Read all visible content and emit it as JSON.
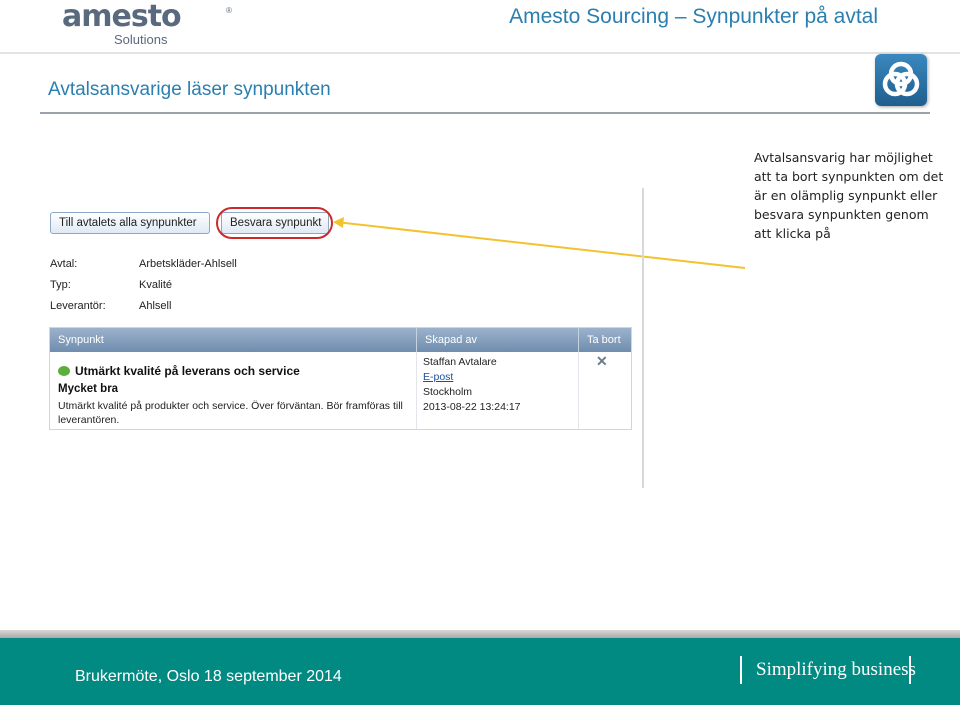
{
  "header": {
    "logo_text": "amesto",
    "logo_registered": "®",
    "logo_sub": "Solutions",
    "title": "Amesto Sourcing – Synpunkter på avtal"
  },
  "slide": {
    "title": "Avtalsansvarige läser synpunkten",
    "callout": "Avtalsansvarig har möjlighet att ta bort synpunkten om det är en olämplig synpunkt eller besvara synpunkten genom att klicka på"
  },
  "screen": {
    "buttons": {
      "all": "Till avtalets alla synpunkter",
      "answer": "Besvara synpunkt"
    },
    "meta": [
      {
        "label": "Avtal:",
        "value": "Arbetskläder-Ahlsell"
      },
      {
        "label": "Typ:",
        "value": "Kvalité"
      },
      {
        "label": "Leverantör:",
        "value": "Ahlsell"
      }
    ],
    "table": {
      "headers": [
        "Synpunkt",
        "Skapad av",
        "Ta bort"
      ],
      "row": {
        "title": "Utmärkt kvalité på leverans och service",
        "rating": "Mycket bra",
        "body": "Utmärkt kvalité på produkter och service. Över förväntan. Bör framföras till leverantören.",
        "created_by": "Staffan Avtalare",
        "email_link": "E-post",
        "city": "Stockholm",
        "timestamp": "2013-08-22 13:24:17"
      }
    }
  },
  "footer": {
    "text": "Brukermöte, Oslo 18 september 2014",
    "slogan": "Simplifying business"
  },
  "colors": {
    "accent": "#2a7fb0",
    "footer": "#008a82",
    "highlight": "#cc2a2a",
    "pointer": "#f3c32e"
  },
  "icons": [
    "amesto-badge-icon",
    "speech-bubble-icon",
    "delete-x-icon"
  ]
}
